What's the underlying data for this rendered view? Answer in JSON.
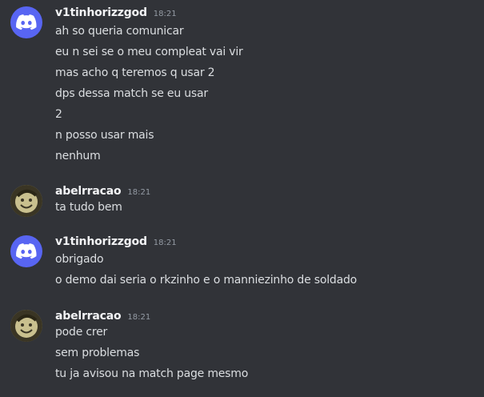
{
  "messages": [
    {
      "author": "v1tinhorizzgod",
      "avatar": "discord-logo-icon",
      "time": "18:21",
      "lines": [
        "ah so queria comunicar",
        "eu n sei se o meu compleat vai vir",
        "mas acho q teremos q usar 2",
        "dps dessa match se eu usar",
        "2",
        "n posso usar mais",
        "nenhum"
      ]
    },
    {
      "author": "abelrracao",
      "avatar": "user-photo-avatar",
      "time": "18:21",
      "lines": [
        "ta tudo bem"
      ]
    },
    {
      "author": "v1tinhorizzgod",
      "avatar": "discord-logo-icon",
      "time": "18:21",
      "lines": [
        "obrigado",
        "o demo dai seria o rkzinho e o manniezinho de soldado"
      ]
    },
    {
      "author": "abelrracao",
      "avatar": "user-photo-avatar",
      "time": "18:21",
      "lines": [
        "pode crer",
        "sem problemas",
        "tu ja avisou na match page mesmo"
      ]
    }
  ],
  "colors": {
    "background": "#313338",
    "discord_blurple": "#5865f2",
    "text": "#dbdee1",
    "username": "#f2f3f5",
    "timestamp": "#949ba4"
  }
}
